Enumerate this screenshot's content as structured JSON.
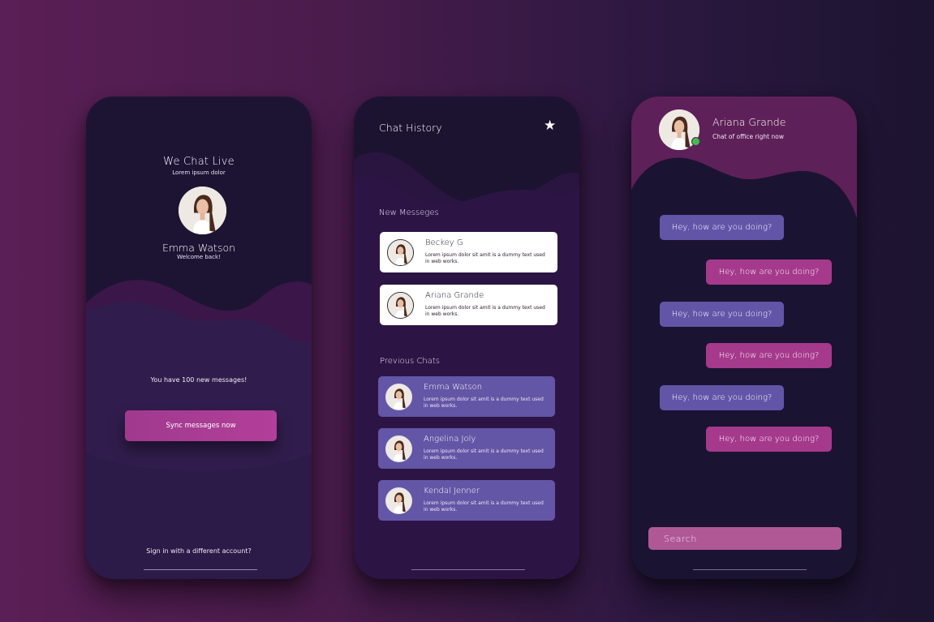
{
  "welcome_screen": {
    "app_title": "We Chat Live",
    "app_subtitle": "Lorem ipsum dolor",
    "user_name": "Emma Watson",
    "welcome_text": "Welcome back!",
    "message_notice": "You have 100 new messages!",
    "sync_button_label": "Sync messages now",
    "signin_link": "Sign in with a different account?"
  },
  "history_screen": {
    "title": "Chat History",
    "star_icon": "star-icon",
    "new_section_title": "New Messeges",
    "new_messages": [
      {
        "name": "Beckey G",
        "text": "Lorem ipsum dolor sit amit is a dummy text used in web works."
      },
      {
        "name": "Ariana Grande",
        "text": "Lorem ipsum dolor sit amit is a dummy text used in web works."
      }
    ],
    "previous_section_title": "Previous Chats",
    "previous_chats": [
      {
        "name": "Emma Watson",
        "text": "Lorem ipsum dolor sit amit is a dummy text used in web works."
      },
      {
        "name": "Angelina Joly",
        "text": "Lorem ipsum dolor sit amit is a dummy text used in web works."
      },
      {
        "name": "Kendal Jenner",
        "text": "Lorem ipsum dolor sit amit is a dummy text used in web works."
      }
    ]
  },
  "chat_screen": {
    "contact_name": "Ariana Grande",
    "contact_status": "Chat of office right now",
    "messages": [
      {
        "direction": "in",
        "text": "Hey, how are  you doing?"
      },
      {
        "direction": "out",
        "text": "Hey, how are  you doing?"
      },
      {
        "direction": "in",
        "text": "Hey, how are  you doing?"
      },
      {
        "direction": "out",
        "text": "Hey, how are  you doing?"
      },
      {
        "direction": "in",
        "text": "Hey, how are  you doing?"
      },
      {
        "direction": "out",
        "text": "Hey, how are  you doing?"
      }
    ],
    "search_placeholder": "Search"
  },
  "colors": {
    "accent_magenta": "#a5398c",
    "accent_purple": "#6255a8",
    "online_green": "#3fbf4a"
  }
}
